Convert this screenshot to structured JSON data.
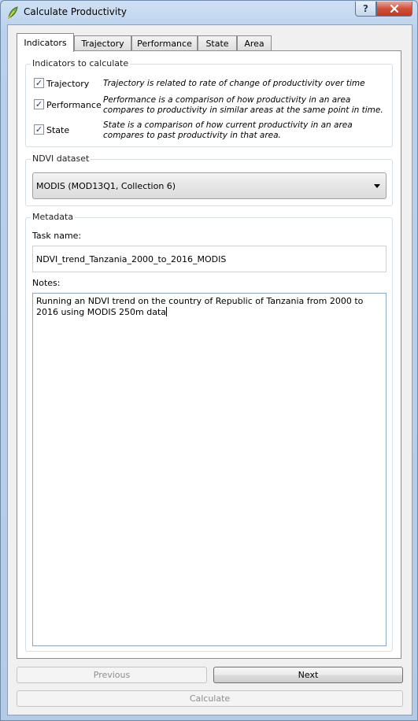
{
  "window": {
    "title": "Calculate Productivity",
    "help_label": "?",
    "close_label": "x"
  },
  "tabs": [
    {
      "label": "Indicators",
      "active": true
    },
    {
      "label": "Trajectory",
      "active": false
    },
    {
      "label": "Performance",
      "active": false
    },
    {
      "label": "State",
      "active": false
    },
    {
      "label": "Area",
      "active": false
    }
  ],
  "indicators": {
    "group_title": "Indicators to calculate",
    "items": [
      {
        "label": "Trajectory",
        "checked": true,
        "description": "Trajectory is related to rate of change of productivity over time"
      },
      {
        "label": "Performance",
        "checked": true,
        "description": "Performance is a comparison of how productivity in an area compares to productivity in similar areas at the same point in time."
      },
      {
        "label": "State",
        "checked": true,
        "description": "State is a comparison of how current productivity in an area compares to past productivity in that area."
      }
    ]
  },
  "ndvi": {
    "group_title": "NDVI dataset",
    "selected": "MODIS (MOD13Q1, Collection 6)"
  },
  "metadata": {
    "group_title": "Metadata",
    "task_name_label": "Task name:",
    "task_name_value": "NDVI_trend_Tanzania_2000_to_2016_MODIS",
    "notes_label": "Notes:",
    "notes_value": "Running an NDVI trend on the country of Republic of Tanzania from 2000 to 2016 using MODIS 250m data"
  },
  "buttons": {
    "previous": "Previous",
    "next": "Next",
    "calculate": "Calculate"
  },
  "colors": {
    "titlebar": "#b9d1ec",
    "close_button": "#c23a22",
    "dialog_bg": "#f0f0f0"
  }
}
